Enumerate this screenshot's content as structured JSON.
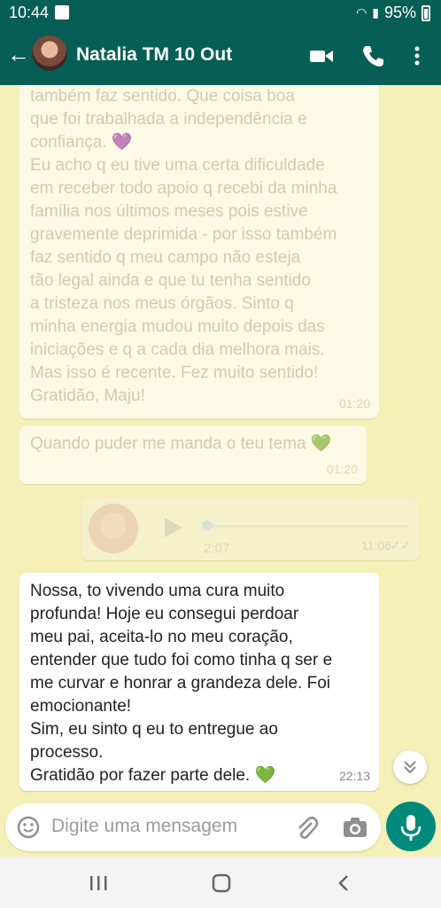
{
  "status": {
    "time": "10:44",
    "battery": "95%"
  },
  "header": {
    "name": "Natalia TM 10 Out"
  },
  "messages": [
    {
      "text": "também faz sentido. Que coisa boa\nque foi trabalhada a independência e\nconfiança. 💜\nEu acho q eu tive uma certa dificuldade\nem receber todo apoio q recebi da minha\nfamília nos últimos meses pois estive\ngravemente deprimida - por isso também\nfaz sentido q meu campo não esteja\ntão legal ainda e que tu tenha sentido\na tristeza nos meus órgãos. Sinto q\nminha energia mudou muito depois das\niniciações e q a cada dia melhora mais.\nMas isso é recente. Fez muito sentido!\nGratidão, Maju!",
      "time": "01:20"
    },
    {
      "text": "Quando puder me manda o teu tema 💚",
      "time": "01:20"
    },
    {
      "duration": "2:07",
      "time": "11:06"
    },
    {
      "text": "Nossa, to vivendo uma cura muito\nprofunda! Hoje eu consegui perdoar\nmeu pai, aceita-lo no meu coração,\nentender que tudo foi como tinha q ser e\nme curvar e honrar a grandeza dele. Foi\nemocionante!\nSim, eu sinto q eu to entregue ao\nprocesso.\nGratidão por fazer parte dele. 💚",
      "time": "22:13"
    }
  ],
  "input": {
    "placeholder": "Digite uma mensagem"
  },
  "colors": {
    "header": "#075e55",
    "background": "#f5f0b8",
    "accent": "#008a7c"
  }
}
